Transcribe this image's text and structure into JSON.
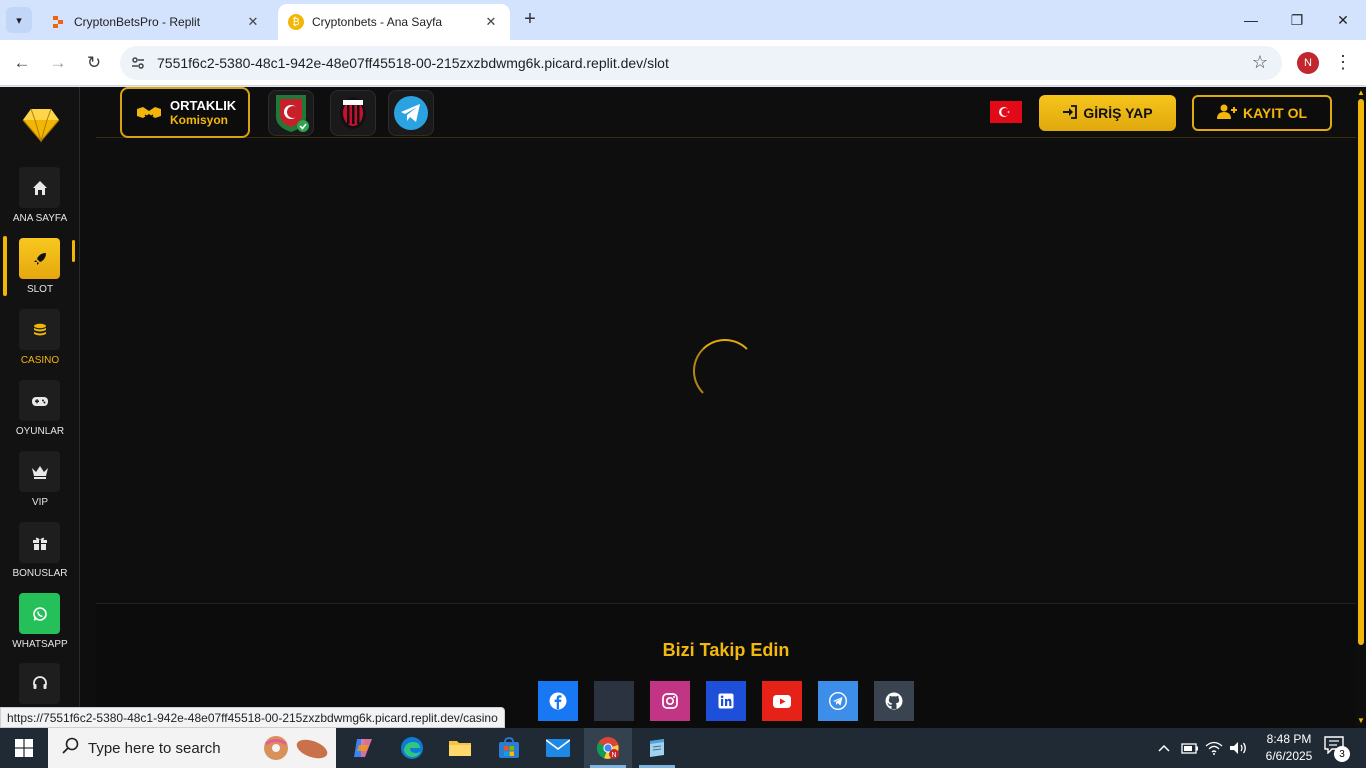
{
  "browser": {
    "tabs": [
      {
        "title": "CryptonBetsPro - Replit",
        "active": false
      },
      {
        "title": "Cryptonbets - Ana Sayfa",
        "active": true
      }
    ],
    "url": "7551f6c2-5380-48c1-942e-48e07ff45518-00-215zxzbdwmg6k.picard.replit.dev/slot",
    "profile_initial": "N",
    "status_url": "https://7551f6c2-5380-48c1-942e-48e07ff45518-00-215zxzbdwmg6k.picard.replit.dev/casino"
  },
  "sidebar": {
    "items": [
      {
        "label": "ANA SAYFA",
        "icon": "home-icon"
      },
      {
        "label": "SLOT",
        "icon": "rocket-icon",
        "active": true
      },
      {
        "label": "CASINO",
        "icon": "coins-icon"
      },
      {
        "label": "OYUNLAR",
        "icon": "gamepad-icon"
      },
      {
        "label": "VIP",
        "icon": "crown-icon"
      },
      {
        "label": "BONUSLAR",
        "icon": "gift-icon"
      },
      {
        "label": "WHATSAPP",
        "icon": "whatsapp-icon"
      },
      {
        "label": "",
        "icon": "headset-icon"
      }
    ]
  },
  "header": {
    "ortaklik_title": "ORTAKLIK",
    "ortaklik_sub": "Komisyon",
    "login_label": "GİRİŞ YAP",
    "register_label": "KAYIT OL",
    "accent": "#f2b705"
  },
  "footer": {
    "title": "Bizi Takip Edin",
    "socials": [
      {
        "name": "facebook",
        "color": "#1877f2"
      },
      {
        "name": "x",
        "color": "#2c3340"
      },
      {
        "name": "instagram",
        "color": "#c13584"
      },
      {
        "name": "linkedin",
        "color": "#0a66c2"
      },
      {
        "name": "youtube",
        "color": "#e62117"
      },
      {
        "name": "telegram",
        "color": "#3d8ee8"
      },
      {
        "name": "github",
        "color": "#3a4350"
      }
    ]
  },
  "taskbar": {
    "search_placeholder": "Type here to search",
    "time": "8:48 PM",
    "date": "6/6/2025",
    "notification_count": "3"
  }
}
